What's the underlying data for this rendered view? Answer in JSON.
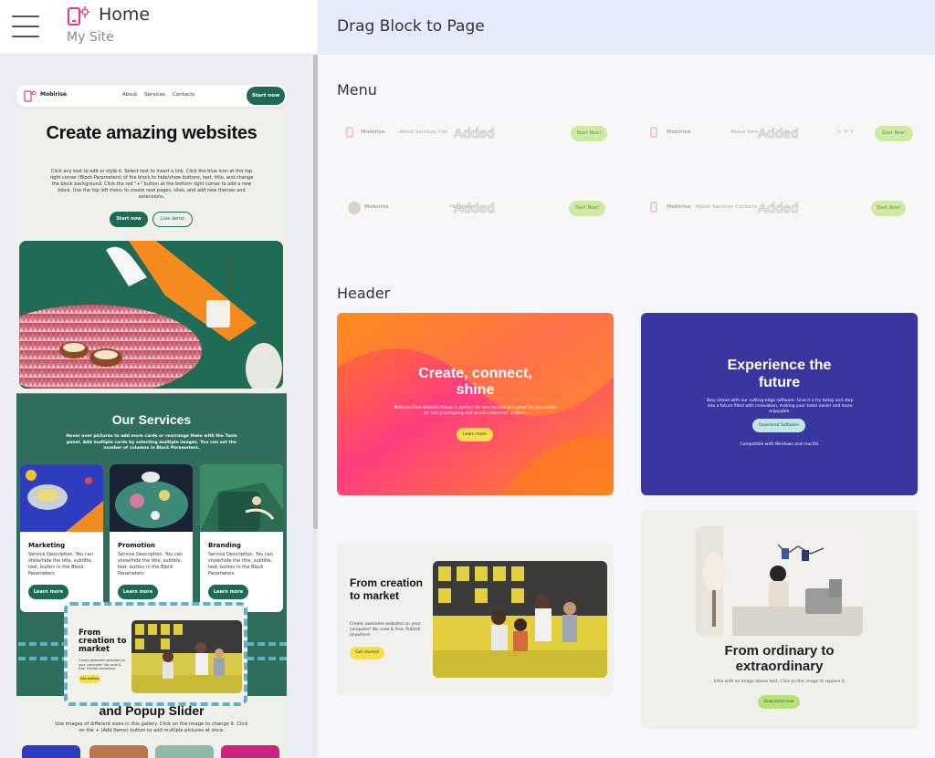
{
  "app": {
    "page_title": "Home",
    "site_name": "My Site"
  },
  "library": {
    "title": "Drag Block to Page",
    "sections": {
      "menu": "Menu",
      "header": "Header"
    },
    "added_label": "Added",
    "menu_blocks": [
      {
        "brand": "Mobirise",
        "links": "About   Services   Con",
        "cta": "Start Now!"
      },
      {
        "brand": "Mobirise",
        "links": "About   Serv",
        "cta": "Start Now!"
      },
      {
        "brand": "Mobirise",
        "links": "Ho           ntacts",
        "cta": "Start Now!"
      },
      {
        "brand": "Mobirise",
        "links": "About   Services   Contacts",
        "cta": "Start Now!"
      }
    ],
    "header_blocks": [
      {
        "title": "Create, connect, shine",
        "text": "Mobirise Free Website Maker is perfect for non-techies and great for pro-coders for fast prototyping and small customers' projects.",
        "button": "Learn more"
      },
      {
        "title": "Experience the future",
        "text": "Stay ahead with our cutting-edge software. Give it a try today and step into a future filled with innovation, making your tasks easier and more enjoyable.",
        "button": "Download Software",
        "note": "Compatible with Windows and macOS."
      },
      {
        "title": "From creation to market",
        "text": "Create awesome websites on your computer! No code & free. Publish anywhere.",
        "button": "Get started"
      },
      {
        "title": "From ordinary to extraordinary",
        "text": "Intro with an image above text. Click on the image to replace it.",
        "button": "Download now"
      }
    ]
  },
  "preview": {
    "menu": {
      "brand": "Mobirise",
      "links": [
        "About",
        "Services",
        "Contacts"
      ],
      "cta": "Start now"
    },
    "hero": {
      "title": "Create amazing websites",
      "text": "Click any text to edit or style it. Select text to insert a link. Click the blue icon at the top right corner (Block Parameters) of the block to hide/show buttons, text, title, and change the block background. Click the red \"+\" button at the bottom right corner to add a new block. Use the top left menu to create new pages, sites, and add new themes and extensions.",
      "start_button": "Start now",
      "live_button": "Live demo"
    },
    "services": {
      "title": "Our Services",
      "text": "Hover over pictures to add more cards or rearrange them with the Tools panel. Add multiple cards by selecting multiple images. You can set the number of columns in Block Parameters.",
      "cards": [
        {
          "title": "Marketing",
          "text": "Service Description. You can show/hide the title, subtitle, text, button in the Block Parameters",
          "button": "Learn more"
        },
        {
          "title": "Promotion",
          "text": "Service Description. You can show/hide the title, subtitle, text, button in the Block Parameters",
          "button": "Learn more"
        },
        {
          "title": "Branding",
          "text": "Service Description. You can show/hide the title, subtitle, text, button in the Block Parameters",
          "button": "Learn more"
        }
      ]
    },
    "gallery": {
      "title": "and Popup Slider",
      "text": "Use images of different sizes in this gallery. Click on the image to change it. Click on the + (Add Items) button to add multiple pictures at once."
    },
    "dragged_block": {
      "title": "From creation to market",
      "text": "Create awesome websites on your computer! No code & free. Publish anywhere.",
      "button": "Get started"
    }
  },
  "colors": {
    "brand_green": "#1e6a54",
    "accent_pink": "#e8368f",
    "drop_indicator": "#5fb3c9",
    "header_purple": "#3b35a0",
    "cta_yellow": "#f4e04d",
    "cta_lime": "#b9e17a"
  }
}
